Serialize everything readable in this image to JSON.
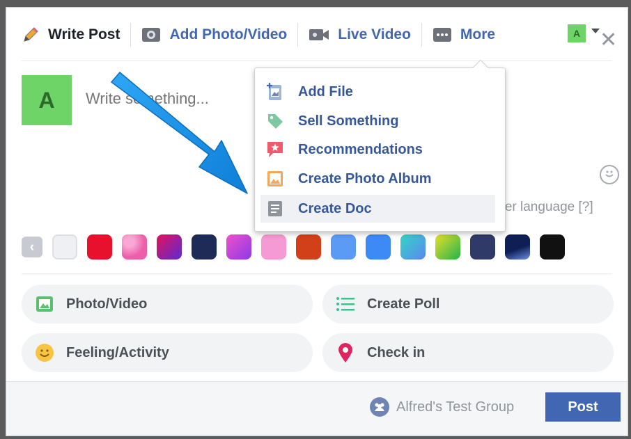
{
  "tabs": [
    {
      "label": "Write Post",
      "icon": "pencil-icon",
      "active": true
    },
    {
      "label": "Add Photo/Video",
      "icon": "camera-icon",
      "active": false
    },
    {
      "label": "Live Video",
      "icon": "video-camera-icon",
      "active": false
    },
    {
      "label": "More",
      "icon": "more-dots-icon",
      "active": false
    }
  ],
  "user": {
    "initial": "A"
  },
  "composer": {
    "placeholder": "Write something...",
    "language_text": "ther language  [?]"
  },
  "more_menu": {
    "items": [
      {
        "label": "Add File",
        "icon": "file-icon"
      },
      {
        "label": "Sell Something",
        "icon": "tag-icon"
      },
      {
        "label": "Recommendations",
        "icon": "star-icon"
      },
      {
        "label": "Create Photo Album",
        "icon": "photo-album-icon"
      },
      {
        "label": "Create Doc",
        "icon": "doc-icon",
        "highlighted": true
      }
    ]
  },
  "backgrounds": [
    "#eef0f3",
    "#e8112d",
    "#f06fb3",
    "#b23ca8",
    "#1c2c57",
    "#c44ee8",
    "#f59ad2",
    "#d2401a",
    "#5b9bf5",
    "#3d8af7",
    "#3ec9c9",
    "#7bd33a",
    "#2f3a68",
    "#1e3570",
    "#111111"
  ],
  "actions": [
    {
      "label": "Photo/Video",
      "icon": "photo-icon"
    },
    {
      "label": "Create Poll",
      "icon": "poll-icon"
    },
    {
      "label": "Feeling/Activity",
      "icon": "smiley-icon"
    },
    {
      "label": "Check in",
      "icon": "location-pin-icon"
    }
  ],
  "footer": {
    "group_name": "Alfred's Test Group",
    "post_label": "Post"
  },
  "colors": {
    "brand": "#4267b2",
    "link": "#365899",
    "arrow": "#1a8fe8"
  }
}
